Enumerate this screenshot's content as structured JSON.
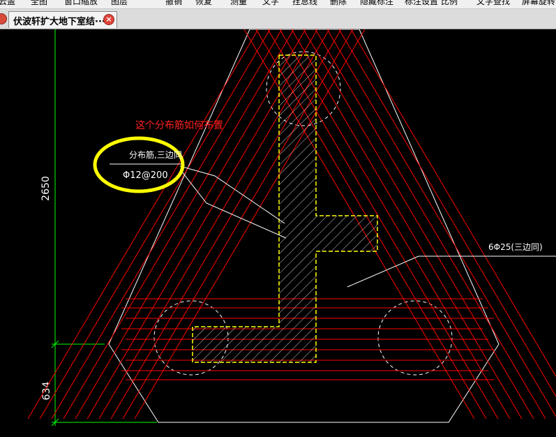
{
  "menu": {
    "items": [
      "云盖",
      "全图",
      "窗口缩放",
      "图层",
      "撤销",
      "恢复",
      "测量",
      "文字",
      "拴息线",
      "删除",
      "隐藏标注",
      "标注设置",
      "比例",
      "文字查找",
      "屏幕旋转"
    ]
  },
  "tab": {
    "title": "伏波轩扩大地下室结···",
    "close_icon": "close-icon"
  },
  "drawing": {
    "question": "这个分布筋如何布置",
    "bar_label_top": "分布筋,三边同",
    "bar_label_bottom": "Φ12@200",
    "main_bar_label": "6Φ25(三边同)",
    "dim_upper": "2650",
    "dim_lower": "634",
    "colors": {
      "background": "#000000",
      "outline": "#ffffff",
      "rebar": "#ff0000",
      "column": "#ffff00",
      "dimension": "#00ff00",
      "highlight": "#ffff00",
      "question": "#ff2020"
    }
  }
}
